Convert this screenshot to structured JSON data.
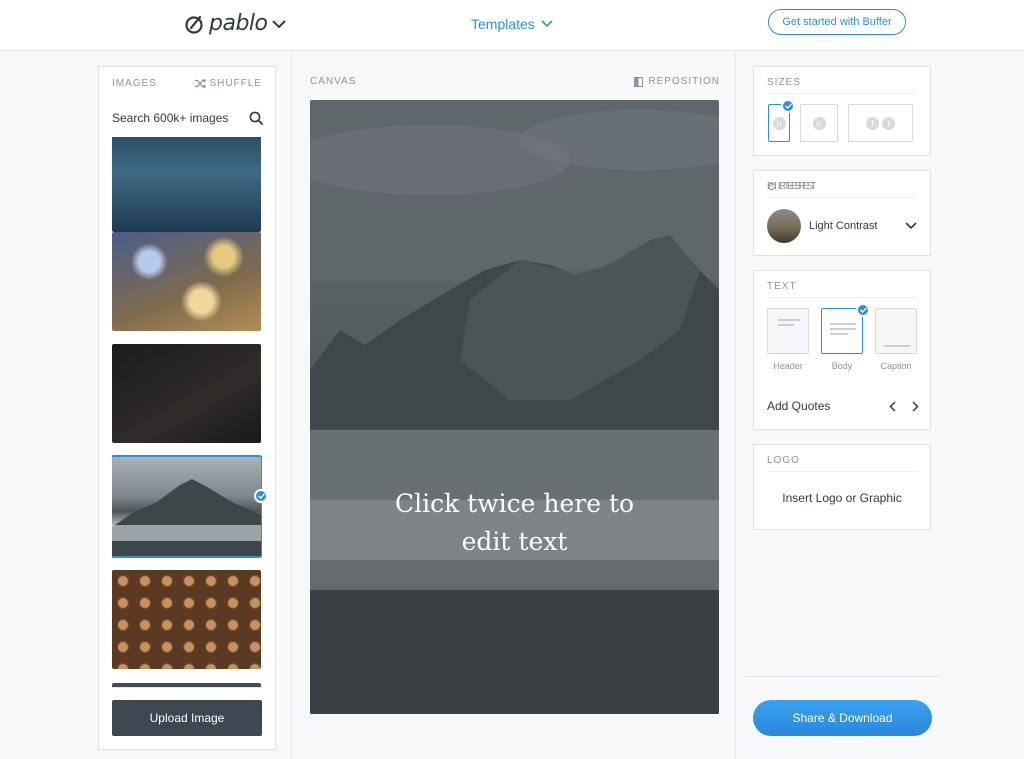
{
  "header": {
    "logo_text": "pablo",
    "templates_label": "Templates",
    "cta_label": "Get started with Buffer"
  },
  "images": {
    "section_label": "IMAGES",
    "shuffle_label": "SHUFFLE",
    "search_placeholder": "Search 600k+ images",
    "upload_label": "Upload Image",
    "selected_index": 3
  },
  "canvas": {
    "section_label": "CANVAS",
    "reposition_label": "REPOSITION",
    "text_line1": "Click twice here to",
    "text_line2": "edit text"
  },
  "sizes": {
    "section_label": "SIZES"
  },
  "filters": {
    "section_label": "FILTERS",
    "reset_label": "RESET",
    "selected_filter": "Light Contrast"
  },
  "text": {
    "section_label": "TEXT",
    "options": [
      "Header",
      "Body",
      "Caption"
    ],
    "selected_option": "Body",
    "quotes_label": "Add Quotes"
  },
  "logo": {
    "section_label": "LOGO",
    "insert_label": "Insert Logo or Graphic"
  },
  "share_label": "Share & Download",
  "colors": {
    "accent": "#2c8ee3",
    "dark_button": "#3d4751",
    "text": "#323b43",
    "muted": "#8c959c"
  }
}
